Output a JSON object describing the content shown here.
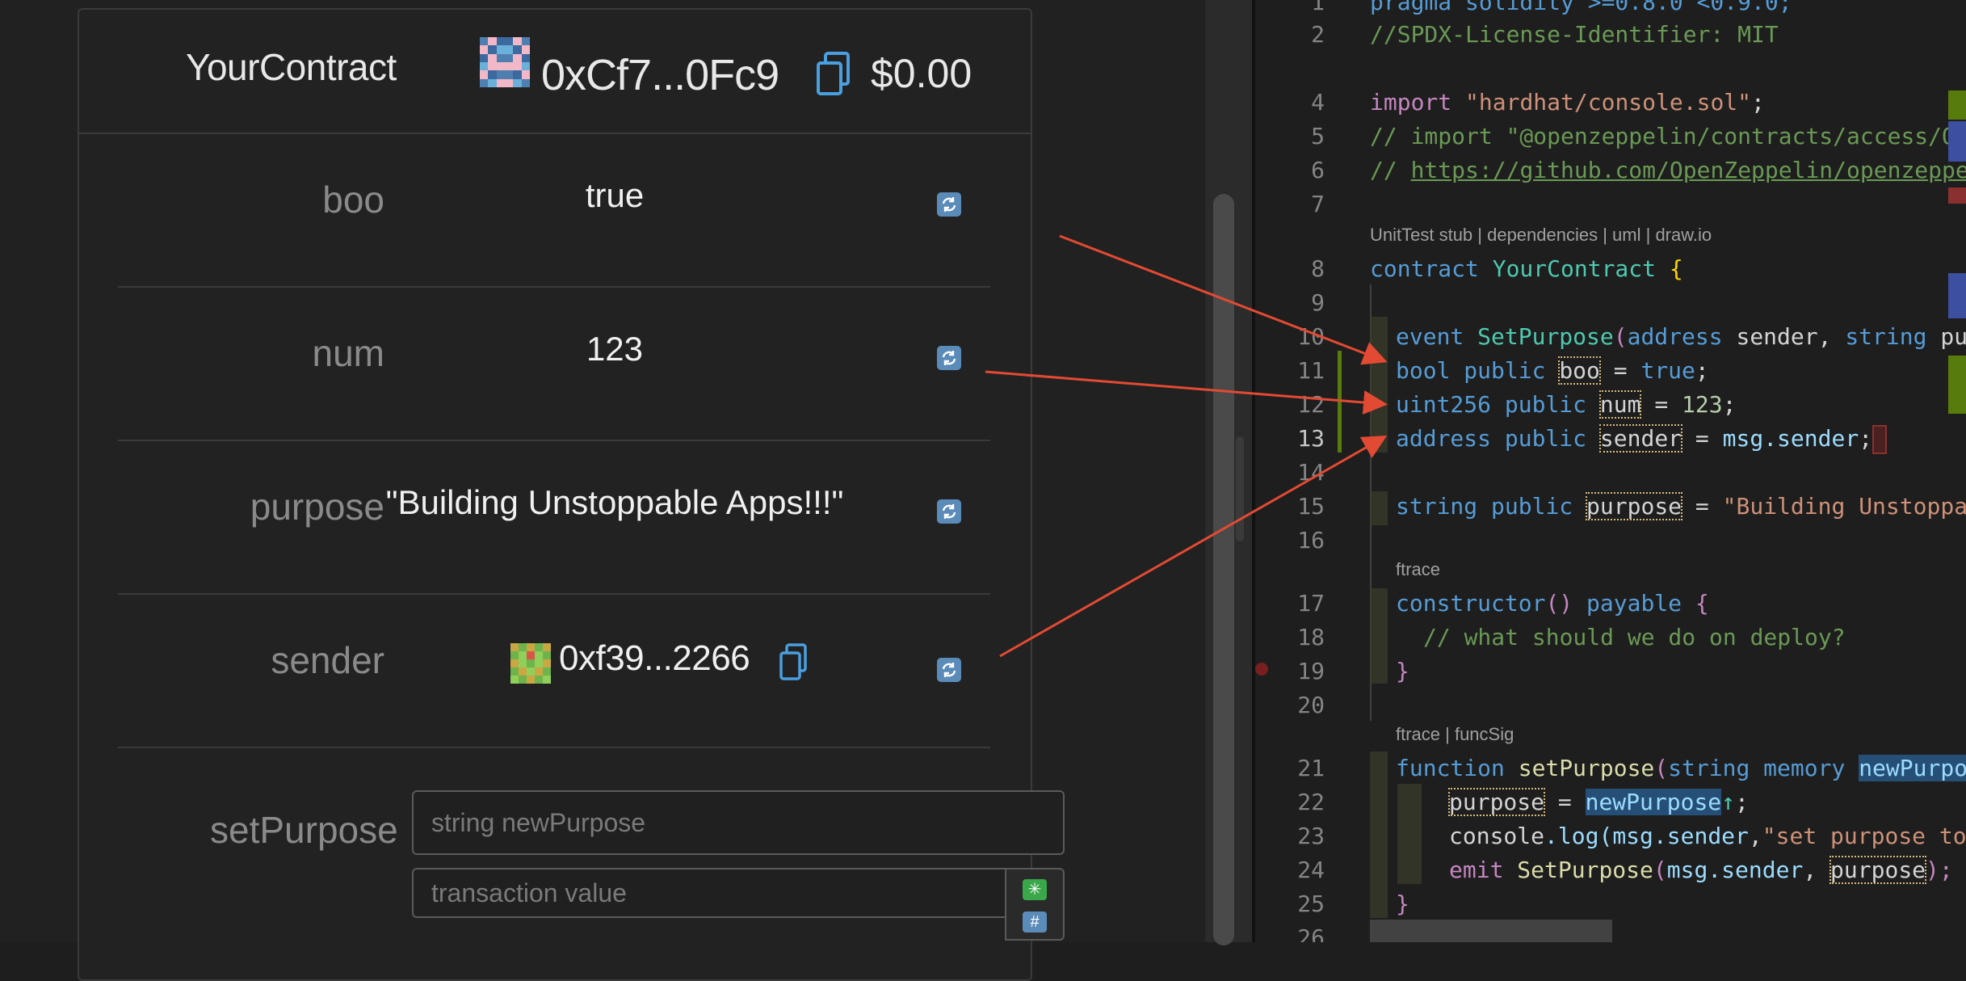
{
  "contract": {
    "title": "YourContract",
    "address": "0xCf7...0Fc9",
    "balance": "$0.00"
  },
  "fields": [
    {
      "label": "boo",
      "value": "true"
    },
    {
      "label": "num",
      "value": "123"
    },
    {
      "label": "purpose",
      "value": "\"Building Unstoppable Apps!!!\""
    },
    {
      "label": "sender",
      "value": "0xf39...2266"
    }
  ],
  "set_purpose": {
    "label": "setPurpose",
    "input_placeholder": "string newPurpose",
    "value_placeholder": "transaction value",
    "multiply_icon": "✳",
    "hash_icon": "#"
  },
  "editor": {
    "line_numbers": [
      "1",
      "2",
      "4",
      "5",
      "6",
      "7",
      "8",
      "9",
      "10",
      "11",
      "12",
      "13",
      "14",
      "15",
      "16",
      "17",
      "18",
      "19",
      "20",
      "21",
      "22",
      "23",
      "24",
      "25",
      "26"
    ],
    "lens_contract": "UnitTest stub | dependencies | uml | draw.io",
    "lens_ftrace": "ftrace",
    "lens_ftrace_funcsig": "ftrace | funcSig",
    "l1": "pragma solidity >=0.8.0 <0.9.0;",
    "l2": "//SPDX-License-Identifier: MIT",
    "l4_kw": "import",
    "l4_str": "\"hardhat/console.sol\"",
    "l4_end": ";",
    "l5": "// import \"@openzeppelin/contracts/access/Ow",
    "l6_a": "// ",
    "l6_link": "https://github.com/OpenZeppelin/openzeppe",
    "l8_kw": "contract",
    "l8_name": "YourContract",
    "l8_brace": "{",
    "l10_kw": "event",
    "l10_name": "SetPurpose",
    "l10_rest1": "(",
    "l10_t1": "address",
    "l10_v1": " sender, ",
    "l10_t2": "string",
    "l10_v2": " pu",
    "l11_t": "bool",
    "l11_p": "public",
    "l11_n": "boo",
    "l11_eq": " = ",
    "l11_v": "true",
    "l11_end": ";",
    "l12_t": "uint256",
    "l12_p": "public",
    "l12_n": "num",
    "l12_eq": " = ",
    "l12_v": "123",
    "l12_end": ";",
    "l13_t": "address",
    "l13_p": "public",
    "l13_n": "sender",
    "l13_eq": " = ",
    "l13_v": "msg.sender",
    "l13_end": ";",
    "l15_t": "string",
    "l15_p": "public",
    "l15_n": "purpose",
    "l15_eq": " = ",
    "l15_v": "\"Building Unstoppa",
    "l17_kw": "constructor",
    "l17_paren": "()",
    "l17_pay": "payable",
    "l17_brace": "{",
    "l18": "// what should we do on deploy?",
    "l19": "}",
    "l21_kw": "function",
    "l21_name": "setPurpose",
    "l21_paren": "(",
    "l21_t": "string",
    "l21_mem": "memory",
    "l21_arg": "newPurpo",
    "l22_a": "purpose",
    "l22_eq": " = ",
    "l22_b": "newPurpose",
    "l22_end": ";",
    "l23_a": "console",
    "l23_b": ".log(",
    "l23_c": "msg.sender",
    "l23_d": ",",
    "l23_e": "\"set purpose to",
    "l24_kw": "emit",
    "l24_name": "SetPurpose",
    "l24_a": "(",
    "l24_b": "msg.sender",
    "l24_c": ", ",
    "l24_d": "purpose",
    "l24_e": ");",
    "l25": "}"
  },
  "colors": {
    "arrow": "#e24a33",
    "refresh_button": "#5b8bb8",
    "copy_icon": "#4a9fe0",
    "gutter_added": "#587c0c"
  }
}
